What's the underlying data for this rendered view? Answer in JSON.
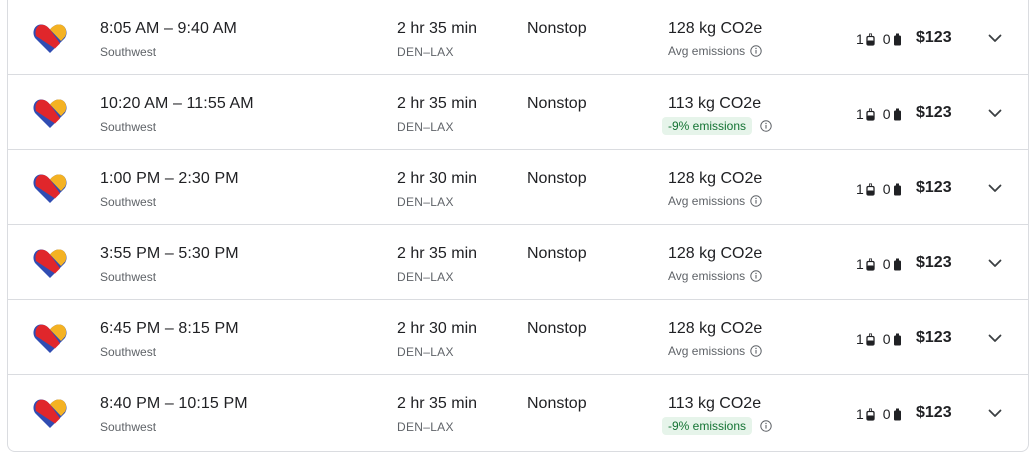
{
  "flights": [
    {
      "times": "8:05 AM – 9:40 AM",
      "airline": "Southwest",
      "duration": "2 hr 35 min",
      "route": "DEN–LAX",
      "stops": "Nonstop",
      "co2": "128 kg CO2e",
      "emissions": "Avg emissions",
      "badge": "",
      "carry_on": "1",
      "checked": "0",
      "price": "$123"
    },
    {
      "times": "10:20 AM – 11:55 AM",
      "airline": "Southwest",
      "duration": "2 hr 35 min",
      "route": "DEN–LAX",
      "stops": "Nonstop",
      "co2": "113 kg CO2e",
      "emissions": "",
      "badge": "-9% emissions",
      "carry_on": "1",
      "checked": "0",
      "price": "$123"
    },
    {
      "times": "1:00 PM – 2:30 PM",
      "airline": "Southwest",
      "duration": "2 hr 30 min",
      "route": "DEN–LAX",
      "stops": "Nonstop",
      "co2": "128 kg CO2e",
      "emissions": "Avg emissions",
      "badge": "",
      "carry_on": "1",
      "checked": "0",
      "price": "$123"
    },
    {
      "times": "3:55 PM – 5:30 PM",
      "airline": "Southwest",
      "duration": "2 hr 35 min",
      "route": "DEN–LAX",
      "stops": "Nonstop",
      "co2": "128 kg CO2e",
      "emissions": "Avg emissions",
      "badge": "",
      "carry_on": "1",
      "checked": "0",
      "price": "$123"
    },
    {
      "times": "6:45 PM – 8:15 PM",
      "airline": "Southwest",
      "duration": "2 hr 30 min",
      "route": "DEN–LAX",
      "stops": "Nonstop",
      "co2": "128 kg CO2e",
      "emissions": "Avg emissions",
      "badge": "",
      "carry_on": "1",
      "checked": "0",
      "price": "$123"
    },
    {
      "times": "8:40 PM – 10:15 PM",
      "airline": "Southwest",
      "duration": "2 hr 35 min",
      "route": "DEN–LAX",
      "stops": "Nonstop",
      "co2": "113 kg CO2e",
      "emissions": "",
      "badge": "-9% emissions",
      "carry_on": "1",
      "checked": "0",
      "price": "$123"
    }
  ],
  "icons": {
    "logo": "southwest-heart-icon",
    "info": "info-icon",
    "carry_on": "carry-on-bag-icon",
    "checked": "checked-bag-icon",
    "expand": "chevron-down-icon"
  },
  "colors": {
    "logo_blue": "#304cb2",
    "logo_red": "#e0262b",
    "logo_yellow": "#f4b223",
    "badge_bg": "#e6f4ea",
    "badge_text": "#137333"
  }
}
